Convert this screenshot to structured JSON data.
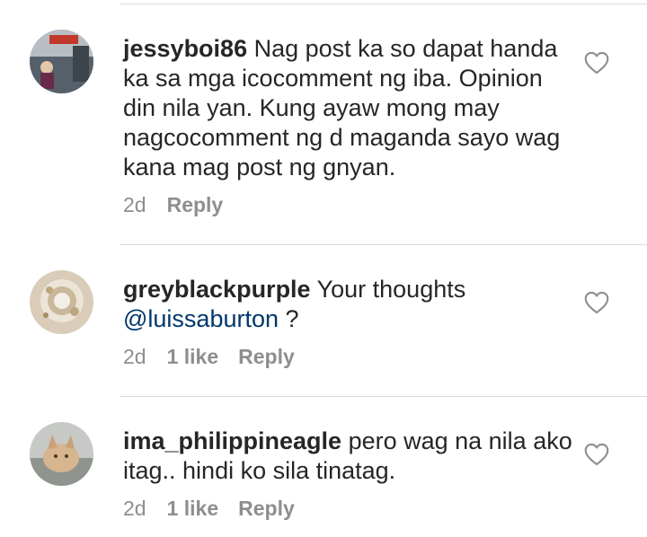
{
  "comments": [
    {
      "username": "jessyboi86",
      "text": " Nag post ka so dapat handa ka sa mga icocomment ng iba. Opinion din nila yan. Kung ayaw mong may nagcocomment ng d maganda sayo wag kana mag post ng gnyan.",
      "time": "2d",
      "likes": "",
      "reply": "Reply",
      "avatar_icon": "user-avatar-photo"
    },
    {
      "username": "greyblackpurple",
      "text": " Your thoughts ",
      "mention": "@luissaburton",
      "text_after": " ?",
      "time": "2d",
      "likes": "1 like",
      "reply": "Reply",
      "avatar_icon": "jewelry-avatar-photo"
    },
    {
      "username": "ima_philippineagle",
      "text": " pero wag na nila ako itag.. hindi ko sila tinatag.",
      "time": "2d",
      "likes": "1 like",
      "reply": "Reply",
      "avatar_icon": "cat-avatar-photo"
    }
  ],
  "colors": {
    "text": "#262626",
    "muted": "#8e8e8e",
    "mention": "#00376b",
    "divider": "#dbdbdb"
  },
  "icons": {
    "like": "heart-outline-icon"
  }
}
